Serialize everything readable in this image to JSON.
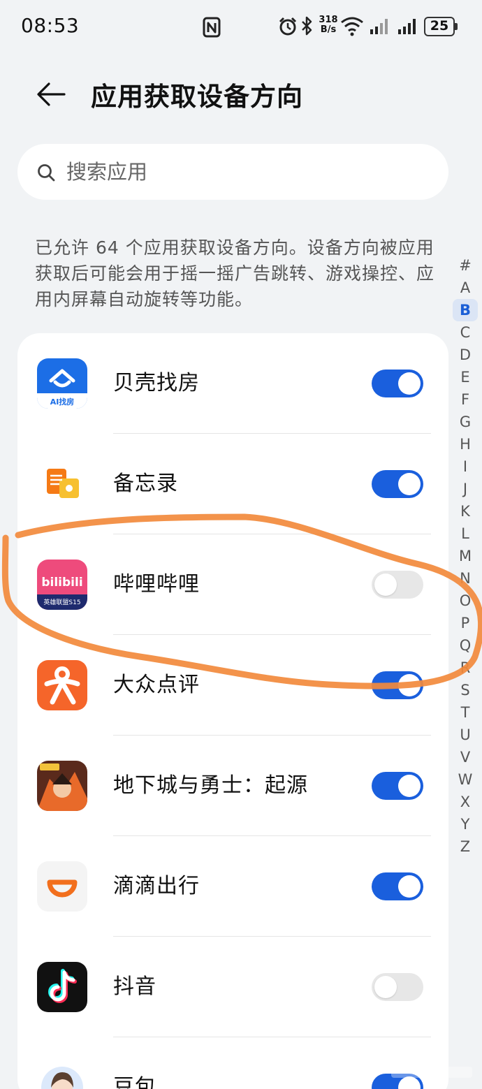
{
  "status_bar": {
    "time": "08:53",
    "speed_value": "318",
    "speed_unit": "B/s",
    "battery": "25",
    "icons": [
      "nfc-icon",
      "alarm-icon",
      "bluetooth-icon",
      "wifi-icon",
      "signal-icon",
      "signal-icon",
      "battery-icon"
    ]
  },
  "header": {
    "title": "应用获取设备方向",
    "back_icon": "back-arrow-icon"
  },
  "search": {
    "placeholder": "搜索应用",
    "value": ""
  },
  "description": "已允许 64 个应用获取设备方向。设备方向被应用获取后可能会用于摇一摇广告跳转、游戏操控、应用内屏幕自动旋转等功能。",
  "alphabet_index": {
    "letters": [
      "#",
      "A",
      "B",
      "C",
      "D",
      "E",
      "F",
      "G",
      "H",
      "I",
      "J",
      "K",
      "L",
      "M",
      "N",
      "O",
      "P",
      "Q",
      "R",
      "S",
      "T",
      "U",
      "V",
      "W",
      "X",
      "Y",
      "Z"
    ],
    "active": "B"
  },
  "apps": [
    {
      "name": "贝壳找房",
      "enabled": true,
      "icon": "beike-icon",
      "icon_label": "AI找房"
    },
    {
      "name": "备忘录",
      "enabled": true,
      "icon": "memo-icon"
    },
    {
      "name": "哔哩哔哩",
      "enabled": false,
      "icon": "bilibili-icon",
      "icon_label": "bilibili",
      "icon_sublabel": "英雄联盟S15"
    },
    {
      "name": "大众点评",
      "enabled": true,
      "icon": "dianping-icon"
    },
    {
      "name": "地下城与勇士：起源",
      "enabled": true,
      "icon": "dnf-icon"
    },
    {
      "name": "滴滴出行",
      "enabled": true,
      "icon": "didi-icon"
    },
    {
      "name": "抖音",
      "enabled": false,
      "icon": "douyin-icon"
    },
    {
      "name": "豆包",
      "enabled": true,
      "icon": "doubao-icon"
    }
  ],
  "colors": {
    "toggle_on": "#1a5fdd",
    "toggle_off": "#e7e7e7",
    "annotation": "#f28a3c",
    "background": "#f1f3f5"
  }
}
